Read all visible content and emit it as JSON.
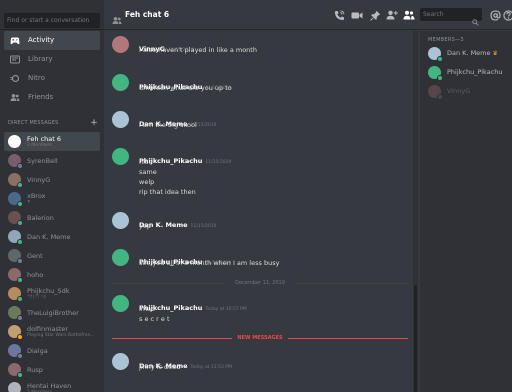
{
  "sidebar": {
    "search_placeholder": "Find or start a conversation",
    "nav": [
      {
        "label": "Activity",
        "icon": "gamepad-icon",
        "active": true
      },
      {
        "label": "Library",
        "icon": "library-icon",
        "active": false
      },
      {
        "label": "Nitro",
        "icon": "nitro-icon",
        "active": false
      },
      {
        "label": "Friends",
        "icon": "friends-icon",
        "active": false
      }
    ],
    "dm_header": "DIRECT MESSAGES",
    "dm_add": "+",
    "dms": [
      {
        "name": "Feh chat 6",
        "sub": "3 Members",
        "active": true,
        "avatar": "#ffffff",
        "status": ""
      },
      {
        "name": "SyrenBell",
        "sub": "",
        "avatar": "#7a5c6e",
        "status": "#747f8d"
      },
      {
        "name": "VinnyG",
        "sub": "",
        "avatar": "#8a7060",
        "status": "#43b581"
      },
      {
        "name": "xBrox",
        "sub": "⯆",
        "avatar": "#4a6a8a",
        "status": "#43b581"
      },
      {
        "name": "Balerion",
        "sub": "",
        "avatar": "#6a5050",
        "status": "#43b581"
      },
      {
        "name": "Dan K. Meme",
        "sub": "",
        "avatar": "#8fa8b8",
        "status": "#43b581"
      },
      {
        "name": "Gent",
        "sub": "",
        "avatar": "#5a6a6a",
        "status": "#747f8d"
      },
      {
        "name": "hoho",
        "sub": "",
        "avatar": "#8a6a6a",
        "status": "#43b581"
      },
      {
        "name": "Phijkchu_Sdk",
        "sub": "ᛘᛗᛒᛉᛚᛜᛞ",
        "avatar": "#b88a60",
        "status": "#43b581"
      },
      {
        "name": "TheLuigiBrother",
        "sub": "",
        "avatar": "#6a7a5a",
        "status": "#747f8d"
      },
      {
        "name": "dolfinmaster",
        "sub": "Playing Star Wars Battlefron...",
        "avatar": "#c0a070",
        "status": "#faa61a"
      },
      {
        "name": "Dialga",
        "sub": "",
        "avatar": "#6a78a0",
        "status": "#747f8d"
      },
      {
        "name": "Rusp",
        "sub": "",
        "avatar": "#8a6a6a",
        "status": "#43b581"
      },
      {
        "name": "Hentai Haven",
        "sub": "2 Members",
        "avatar": "#b0b4ba",
        "status": ""
      }
    ]
  },
  "header": {
    "title": "Feh chat 6",
    "search_placeholder": "Search",
    "icons": [
      "phone-call-icon",
      "video-call-icon",
      "pin-icon",
      "add-member-icon",
      "members-list-icon",
      "search-icon",
      "mention-icon",
      "help-icon"
    ]
  },
  "messages": [
    {
      "author": "VinnyG",
      "time": "11/15/2019",
      "lines": [
        "I also haven't played in like a month"
      ],
      "avatar": "#b0787a"
    },
    {
      "author": "Phijkchu_Pikachu",
      "time": "11/15/2019",
      "lines": [
        "umbreon what are you up to"
      ],
      "avatar": "#43b581"
    },
    {
      "author": "Dan K. Meme",
      "time": "11/15/2019",
      "lines": [
        "i am the big skool"
      ],
      "avatar": "#a9c4d4"
    },
    {
      "author": "Phijkchu_Pikachu",
      "time": "11/15/2019",
      "lines": [
        "nice",
        "same",
        "welp",
        "rip that idea then"
      ],
      "avatar": "#43b581"
    },
    {
      "author": "Dan K. Meme",
      "time": "11/15/2019",
      "lines": [
        "yep"
      ],
      "avatar": "#a9c4d4"
    },
    {
      "author": "Phijkchu_Pikachu",
      "time": "11/15/2019",
      "lines": [
        "see you all in a month when I am less busy"
      ],
      "avatar": "#43b581"
    },
    {
      "author": "Phijkchu_Pikachu",
      "time": "Today at 10:57 PM",
      "lines": [
        "lmao",
        "s e c r e t"
      ],
      "avatar": "#43b581"
    },
    {
      "author": "Dan K. Meme",
      "time": "Today at 11:53 PM",
      "lines": [
        "jinny is dead"
      ],
      "avatar": "#a9c4d4"
    }
  ],
  "dividers": {
    "date": "December 11, 2019",
    "new_messages": "NEW MESSAGES"
  },
  "members": {
    "title": "MEMBERS—3",
    "list": [
      {
        "name": "Dan K. Meme",
        "avatar": "#a9c4d4",
        "status": "#43b581",
        "owner": true,
        "offline": false
      },
      {
        "name": "Phijkchu_Pikachu",
        "avatar": "#43b581",
        "status": "#43b581",
        "owner": false,
        "offline": false
      },
      {
        "name": "VinnyG",
        "avatar": "#b0787a",
        "status": "#747f8d",
        "owner": false,
        "offline": true
      }
    ],
    "owner_glyph": "♛"
  },
  "colors": {
    "accent": "#7289da",
    "online": "#43b581",
    "idle": "#faa61a",
    "offline": "#747f8d",
    "new_messages": "#f04747"
  }
}
